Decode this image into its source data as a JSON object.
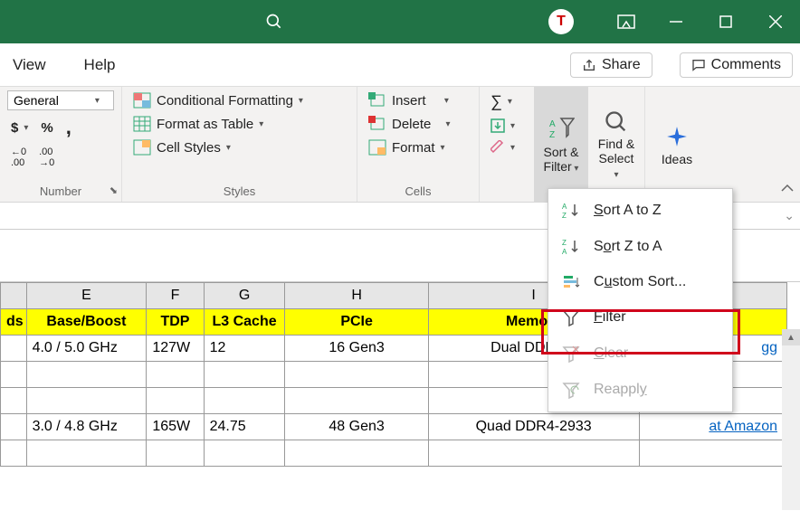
{
  "titlebar": {
    "avatar_letter": "T"
  },
  "menubar": {
    "view": "View",
    "help": "Help",
    "share": "Share",
    "comments": "Comments"
  },
  "ribbon": {
    "number": {
      "label": "Number",
      "format_select": "General",
      "currency": "$",
      "percent": "%",
      "comma": ",",
      "inc_dec": ".0",
      "inc_dec2": ".00"
    },
    "styles": {
      "label": "Styles",
      "cond_format": "Conditional Formatting",
      "format_table": "Format as Table",
      "cell_styles": "Cell Styles"
    },
    "cells": {
      "label": "Cells",
      "insert": "Insert",
      "delete": "Delete",
      "format": "Format"
    },
    "editing": {
      "sort_filter": "Sort & Filter",
      "find_select": "Find & Select",
      "ideas": "Ideas"
    }
  },
  "dropdown": {
    "sort_az": "Sort A to Z",
    "sort_za": "Sort Z to A",
    "custom_sort": "Custom Sort...",
    "filter": "Filter",
    "clear": "Clear",
    "reapply": "Reapply"
  },
  "sheet": {
    "col_letters": [
      "",
      "E",
      "F",
      "G",
      "H",
      "I",
      ""
    ],
    "headers": [
      "ds",
      "Base/Boost",
      "TDP",
      "L3 Cache",
      "PCIe",
      "Memory",
      ""
    ],
    "rows": [
      {
        "c0": "",
        "c1": "4.0 / 5.0 GHz",
        "c2": "127W",
        "c3": "12",
        "c4": "16 Gen3",
        "c5": "Dual DDR4-2",
        "c6": "gg"
      },
      {
        "c0": "",
        "c1": "",
        "c2": "",
        "c3": "",
        "c4": "",
        "c5": "",
        "c6": ""
      },
      {
        "c0": "",
        "c1": "3.0 / 4.8 GHz",
        "c2": "165W",
        "c3": "24.75",
        "c4": "48 Gen3",
        "c5": "Quad DDR4-2933",
        "c6": "at Amazon"
      },
      {
        "c0": "",
        "c1": "",
        "c2": "",
        "c3": "",
        "c4": "",
        "c5": "",
        "c6": ""
      }
    ]
  }
}
